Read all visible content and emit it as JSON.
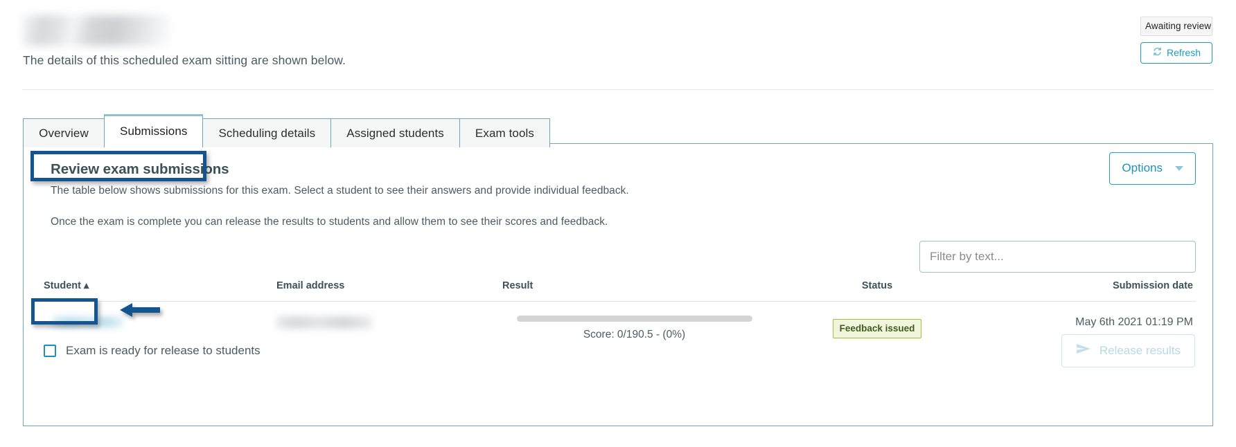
{
  "header": {
    "title_redacted": true,
    "subtitle": "The details of this scheduled exam sitting are shown below.",
    "status_pill": "Awaiting review",
    "refresh_label": "Refresh",
    "refresh_icon": "refresh-icon"
  },
  "tabs": [
    {
      "label": "Overview",
      "active": false
    },
    {
      "label": "Submissions",
      "active": true
    },
    {
      "label": "Scheduling details",
      "active": false
    },
    {
      "label": "Assigned students",
      "active": false
    },
    {
      "label": "Exam tools",
      "active": false
    }
  ],
  "panel": {
    "section_title": "Review exam submissions",
    "paragraph_1": "The table below shows submissions for this exam. Select a student to see their answers and provide individual feedback.",
    "paragraph_2": "Once the exam is complete you can release the results to students and allow them to see their scores and feedback.",
    "options_label": "Options",
    "options_icon": "chevron-down-icon"
  },
  "filter": {
    "placeholder": "Filter by text...",
    "value": ""
  },
  "table": {
    "columns": [
      {
        "label": "Student",
        "sort_indicator": "▴"
      },
      {
        "label": "Email address"
      },
      {
        "label": "Result"
      },
      {
        "label": "Status"
      },
      {
        "label": "Submission date"
      }
    ],
    "student_header_with_sort": "Student ▴",
    "rows": [
      {
        "student": "",
        "student_redacted": true,
        "email": "",
        "email_redacted": true,
        "score_text": "Score: 0/190.5 - (0%)",
        "score_value": 0,
        "score_max": 190.5,
        "score_percent": 0,
        "status_badge": "Feedback issued",
        "submission_date": "May 6th 2021 01:19 PM"
      }
    ]
  },
  "footer": {
    "checkbox_label": "Exam is ready for release to students",
    "checkbox_checked": false,
    "release_label": "Release results",
    "release_icon": "send-icon",
    "release_disabled": true
  },
  "colors": {
    "accent_teal": "#1a93ba",
    "panel_border": "#6aa7ba",
    "annotation_navy": "#14548f",
    "badge_green_border": "#9fbf3b",
    "badge_green_bg": "#f0f5dc",
    "badge_green_text": "#3f5b20",
    "text": "#4a5b63",
    "tab_inactive_bg": "#f5f6f6",
    "active_tab_top": "#8fc0d2"
  },
  "annotations": [
    {
      "name": "highlight-box-section-title",
      "shape": "rectangle",
      "color": "#14548f"
    },
    {
      "name": "highlight-box-student-column",
      "shape": "rectangle",
      "color": "#14548f"
    },
    {
      "name": "pointer-arrow-student-name",
      "shape": "left-arrow",
      "color": "#14548f"
    }
  ]
}
